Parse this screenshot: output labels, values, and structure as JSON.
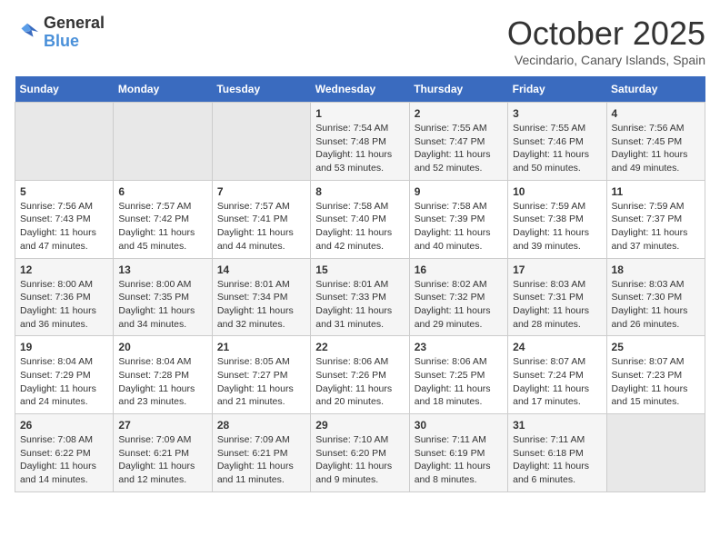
{
  "header": {
    "logo_line1": "General",
    "logo_line2": "Blue",
    "month": "October 2025",
    "location": "Vecindario, Canary Islands, Spain"
  },
  "weekdays": [
    "Sunday",
    "Monday",
    "Tuesday",
    "Wednesday",
    "Thursday",
    "Friday",
    "Saturday"
  ],
  "weeks": [
    [
      {
        "day": "",
        "content": ""
      },
      {
        "day": "",
        "content": ""
      },
      {
        "day": "",
        "content": ""
      },
      {
        "day": "1",
        "content": "Sunrise: 7:54 AM\nSunset: 7:48 PM\nDaylight: 11 hours\nand 53 minutes."
      },
      {
        "day": "2",
        "content": "Sunrise: 7:55 AM\nSunset: 7:47 PM\nDaylight: 11 hours\nand 52 minutes."
      },
      {
        "day": "3",
        "content": "Sunrise: 7:55 AM\nSunset: 7:46 PM\nDaylight: 11 hours\nand 50 minutes."
      },
      {
        "day": "4",
        "content": "Sunrise: 7:56 AM\nSunset: 7:45 PM\nDaylight: 11 hours\nand 49 minutes."
      }
    ],
    [
      {
        "day": "5",
        "content": "Sunrise: 7:56 AM\nSunset: 7:43 PM\nDaylight: 11 hours\nand 47 minutes."
      },
      {
        "day": "6",
        "content": "Sunrise: 7:57 AM\nSunset: 7:42 PM\nDaylight: 11 hours\nand 45 minutes."
      },
      {
        "day": "7",
        "content": "Sunrise: 7:57 AM\nSunset: 7:41 PM\nDaylight: 11 hours\nand 44 minutes."
      },
      {
        "day": "8",
        "content": "Sunrise: 7:58 AM\nSunset: 7:40 PM\nDaylight: 11 hours\nand 42 minutes."
      },
      {
        "day": "9",
        "content": "Sunrise: 7:58 AM\nSunset: 7:39 PM\nDaylight: 11 hours\nand 40 minutes."
      },
      {
        "day": "10",
        "content": "Sunrise: 7:59 AM\nSunset: 7:38 PM\nDaylight: 11 hours\nand 39 minutes."
      },
      {
        "day": "11",
        "content": "Sunrise: 7:59 AM\nSunset: 7:37 PM\nDaylight: 11 hours\nand 37 minutes."
      }
    ],
    [
      {
        "day": "12",
        "content": "Sunrise: 8:00 AM\nSunset: 7:36 PM\nDaylight: 11 hours\nand 36 minutes."
      },
      {
        "day": "13",
        "content": "Sunrise: 8:00 AM\nSunset: 7:35 PM\nDaylight: 11 hours\nand 34 minutes."
      },
      {
        "day": "14",
        "content": "Sunrise: 8:01 AM\nSunset: 7:34 PM\nDaylight: 11 hours\nand 32 minutes."
      },
      {
        "day": "15",
        "content": "Sunrise: 8:01 AM\nSunset: 7:33 PM\nDaylight: 11 hours\nand 31 minutes."
      },
      {
        "day": "16",
        "content": "Sunrise: 8:02 AM\nSunset: 7:32 PM\nDaylight: 11 hours\nand 29 minutes."
      },
      {
        "day": "17",
        "content": "Sunrise: 8:03 AM\nSunset: 7:31 PM\nDaylight: 11 hours\nand 28 minutes."
      },
      {
        "day": "18",
        "content": "Sunrise: 8:03 AM\nSunset: 7:30 PM\nDaylight: 11 hours\nand 26 minutes."
      }
    ],
    [
      {
        "day": "19",
        "content": "Sunrise: 8:04 AM\nSunset: 7:29 PM\nDaylight: 11 hours\nand 24 minutes."
      },
      {
        "day": "20",
        "content": "Sunrise: 8:04 AM\nSunset: 7:28 PM\nDaylight: 11 hours\nand 23 minutes."
      },
      {
        "day": "21",
        "content": "Sunrise: 8:05 AM\nSunset: 7:27 PM\nDaylight: 11 hours\nand 21 minutes."
      },
      {
        "day": "22",
        "content": "Sunrise: 8:06 AM\nSunset: 7:26 PM\nDaylight: 11 hours\nand 20 minutes."
      },
      {
        "day": "23",
        "content": "Sunrise: 8:06 AM\nSunset: 7:25 PM\nDaylight: 11 hours\nand 18 minutes."
      },
      {
        "day": "24",
        "content": "Sunrise: 8:07 AM\nSunset: 7:24 PM\nDaylight: 11 hours\nand 17 minutes."
      },
      {
        "day": "25",
        "content": "Sunrise: 8:07 AM\nSunset: 7:23 PM\nDaylight: 11 hours\nand 15 minutes."
      }
    ],
    [
      {
        "day": "26",
        "content": "Sunrise: 7:08 AM\nSunset: 6:22 PM\nDaylight: 11 hours\nand 14 minutes."
      },
      {
        "day": "27",
        "content": "Sunrise: 7:09 AM\nSunset: 6:21 PM\nDaylight: 11 hours\nand 12 minutes."
      },
      {
        "day": "28",
        "content": "Sunrise: 7:09 AM\nSunset: 6:21 PM\nDaylight: 11 hours\nand 11 minutes."
      },
      {
        "day": "29",
        "content": "Sunrise: 7:10 AM\nSunset: 6:20 PM\nDaylight: 11 hours\nand 9 minutes."
      },
      {
        "day": "30",
        "content": "Sunrise: 7:11 AM\nSunset: 6:19 PM\nDaylight: 11 hours\nand 8 minutes."
      },
      {
        "day": "31",
        "content": "Sunrise: 7:11 AM\nSunset: 6:18 PM\nDaylight: 11 hours\nand 6 minutes."
      },
      {
        "day": "",
        "content": ""
      }
    ]
  ]
}
